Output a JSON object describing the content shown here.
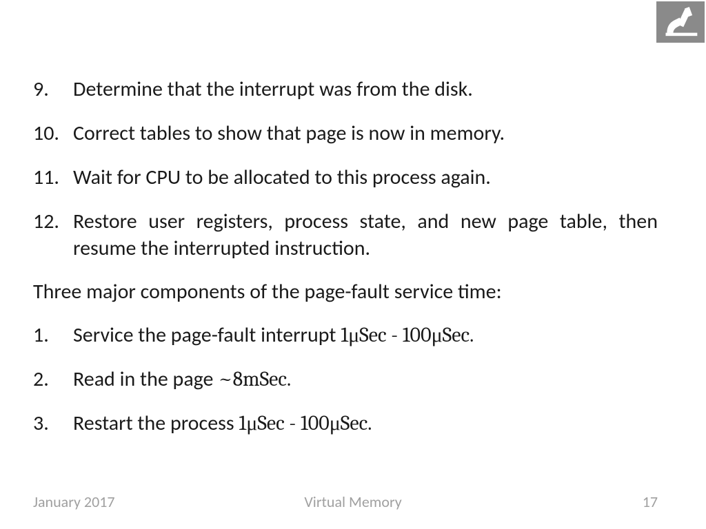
{
  "list_items": [
    {
      "num": "9.",
      "text": "Determine that the interrupt was from the disk."
    },
    {
      "num": "10.",
      "text": "Correct tables to show that page is now in memory."
    },
    {
      "num": "11.",
      "text": "Wait for CPU to be allocated to this process again."
    },
    {
      "num": "12.",
      "text": "Restore user registers, process state, and new page table, then resume the interrupted instruction."
    }
  ],
  "section_title": "Three major components of the page-fault service time:",
  "sub_list_items": [
    {
      "num": "1.",
      "text_prefix": "Service the page-fault interrupt ",
      "math": "1μSec - 100μSec."
    },
    {
      "num": "2.",
      "text_prefix": "Read in the page ",
      "math": "~8mSec."
    },
    {
      "num": "3.",
      "text_prefix": "Restart the process ",
      "math": "1μSec - 100μSec."
    }
  ],
  "footer": {
    "left": "January 2017",
    "center": "Virtual Memory",
    "right": "17"
  }
}
